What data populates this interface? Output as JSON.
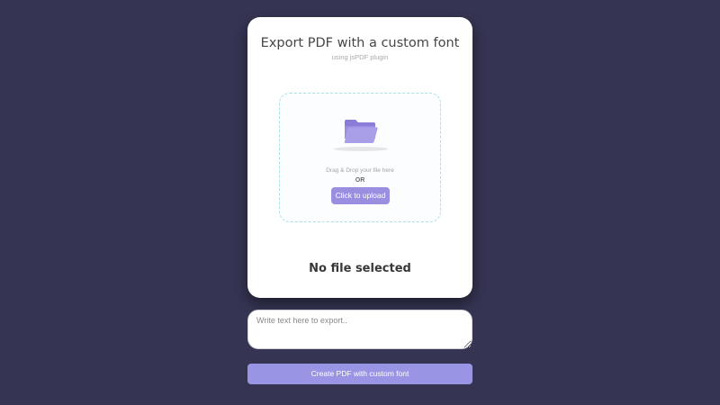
{
  "card": {
    "title": "Export PDF with a custom font",
    "subtitle": "using jsPDF plugin"
  },
  "dropzone": {
    "icon": "folder-open-icon",
    "drag_text": "Drag & Drop your file here",
    "or_text": "OR",
    "upload_label": "Click to upload"
  },
  "status": {
    "file_status": "No file selected"
  },
  "export": {
    "placeholder": "Write text here to export..",
    "button_label": "Create PDF with custom font"
  },
  "colors": {
    "background": "#353452",
    "accent": "#9a8ee0",
    "dropzone_border": "#a9e1e6"
  }
}
